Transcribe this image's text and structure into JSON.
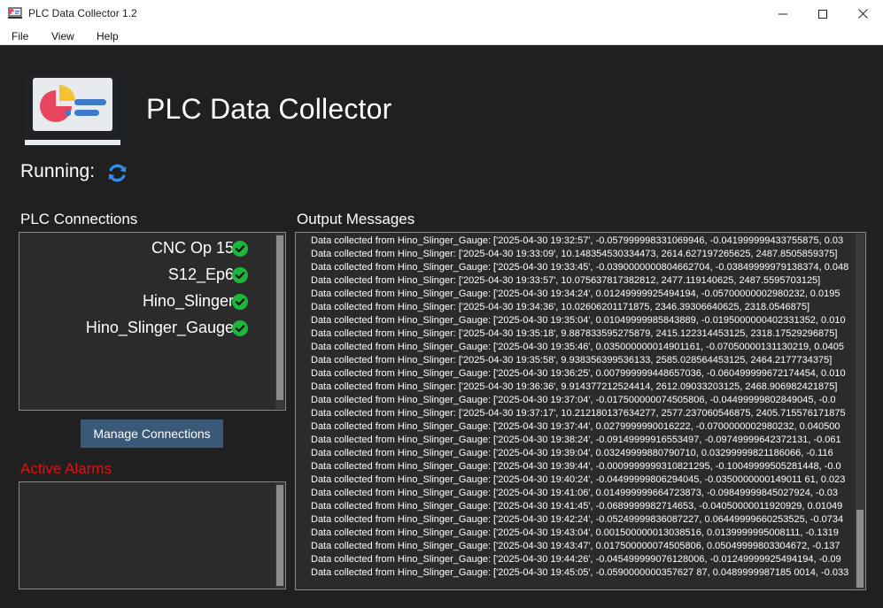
{
  "window": {
    "title": "PLC Data Collector 1.2",
    "minimize_icon": "minimize-icon",
    "maximize_icon": "maximize-icon",
    "close_icon": "close-icon"
  },
  "menu": [
    "File",
    "View",
    "Help"
  ],
  "header": {
    "title": "PLC Data Collector",
    "running_label": "Running:",
    "running_icon": "refresh-icon"
  },
  "plc_connections": {
    "label": "PLC Connections",
    "items": [
      {
        "name": "CNC Op 15",
        "status": "connected"
      },
      {
        "name": "S12_Ep6",
        "status": "connected"
      },
      {
        "name": "Hino_Slinger",
        "status": "connected"
      },
      {
        "name": "Hino_Slinger_Gauge",
        "status": "connected"
      }
    ]
  },
  "manage_button": "Manage Connections",
  "alarms": {
    "label": "Active Alarms",
    "items": []
  },
  "output": {
    "label": "Output Messages",
    "messages": [
      "Data collected from Hino_Slinger_Gauge: ['2025-04-30 19:32:57', -0.057999998331069946, -0.041999999433755875, 0.03",
      "Data collected from Hino_Slinger: ['2025-04-30 19:33:09', 10.148354530334473, 2614.627197265625, 2487.8505859375]",
      "Data collected from Hino_Slinger_Gauge: ['2025-04-30 19:33:45', -0.0390000000804662704, -0.03849999979138374, 0.048",
      "Data collected from Hino_Slinger: ['2025-04-30 19:33:57', 10.075637817382812, 2477.119140625, 2487.5595703125]",
      "Data collected from Hino_Slinger_Gauge: ['2025-04-30 19:34:24', 0.01249999925494194, -0.05700000002980232, 0.0195",
      "Data collected from Hino_Slinger: ['2025-04-30 19:34:36', 10.02606201171875, 2346.39306640625, 2318.0546875]",
      "Data collected from Hino_Slinger_Gauge: ['2025-04-30 19:35:04', 0.01049999985843889, -0.0195000000402331352, 0.010",
      "Data collected from Hino_Slinger: ['2025-04-30 19:35:18', 9.887833595275879, 2415.122314453125, 2318.17529296875]",
      "Data collected from Hino_Slinger_Gauge: ['2025-04-30 19:35:46', 0.035000000014901161, -0.07050000131130219, 0.0405",
      "Data collected from Hino_Slinger: ['2025-04-30 19:35:58', 9.938356399536133, 2585.028564453125, 2464.2177734375]",
      "Data collected from Hino_Slinger_Gauge: ['2025-04-30 19:36:25', 0.007999999448657036, -0.060499999672174454, 0.010",
      "Data collected from Hino_Slinger: ['2025-04-30 19:36:36', 9.914377212524414, 2612.09033203125, 2468.906982421875]",
      "Data collected from Hino_Slinger_Gauge: ['2025-04-30 19:37:04', -0.017500000074505806, -0.04499999802849045, -0.0",
      "Data collected from Hino_Slinger: ['2025-04-30 19:37:17', 10.212180137634277, 2577.237060546875, 2405.715576171875",
      "Data collected from Hino_Slinger_Gauge: ['2025-04-30 19:37:44', 0.0279999990016222, -0.0700000002980232, 0.040500",
      "Data collected from Hino_Slinger_Gauge: ['2025-04-30 19:38:24', -0.09149999916553497, -0.09749999642372131, -0.061",
      "Data collected from Hino_Slinger_Gauge: ['2025-04-30 19:39:04', 0.03249999880790710, 0.03299999821186066, -0.116",
      "Data collected from Hino_Slinger_Gauge: ['2025-04-30 19:39:44', -0.0009999999310821295, -0.10049999505281448, -0.0",
      "Data collected from Hino_Slinger_Gauge: ['2025-04-30 19:40:24', -0.04499999806294045, -0.0350000000149011 61, 0.023",
      "Data collected from Hino_Slinger_Gauge: ['2025-04-30 19:41:06', 0.014999999664723873, -0.09849999845027924, -0.03",
      "Data collected from Hino_Slinger_Gauge: ['2025-04-30 19:41:45', -0.0689999982714653, -0.04050000011920929, 0.01049",
      "Data collected from Hino_Slinger_Gauge: ['2025-04-30 19:42:24', -0.05249999836087227, 0.06449999660253525, -0.0734",
      "Data collected from Hino_Slinger_Gauge: ['2025-04-30 19:43:04', 0.001500000013038516, 0.0139999995008111, -0.1319",
      "Data collected from Hino_Slinger_Gauge: ['2025-04-30 19:43:47', 0.017500000074505806, 0.05049999803304672, -0.137",
      "Data collected from Hino_Slinger_Gauge: ['2025-04-30 19:44:26', -0.045499999076128006, -0.01249999925494194, -0.09",
      "Data collected from Hino_Slinger_Gauge: ['2025-04-30 19:45:05', -0.0590000000357627 87, 0.0489999987185 0014, -0.033"
    ]
  },
  "icons": {
    "app": "app-logo-icon",
    "check": "check-circle-icon"
  },
  "colors": {
    "background": "#202020",
    "panel": "#2b2b2b",
    "button": "#3a5877",
    "alarm_label": "#e3100f",
    "check": "#1db53a"
  }
}
